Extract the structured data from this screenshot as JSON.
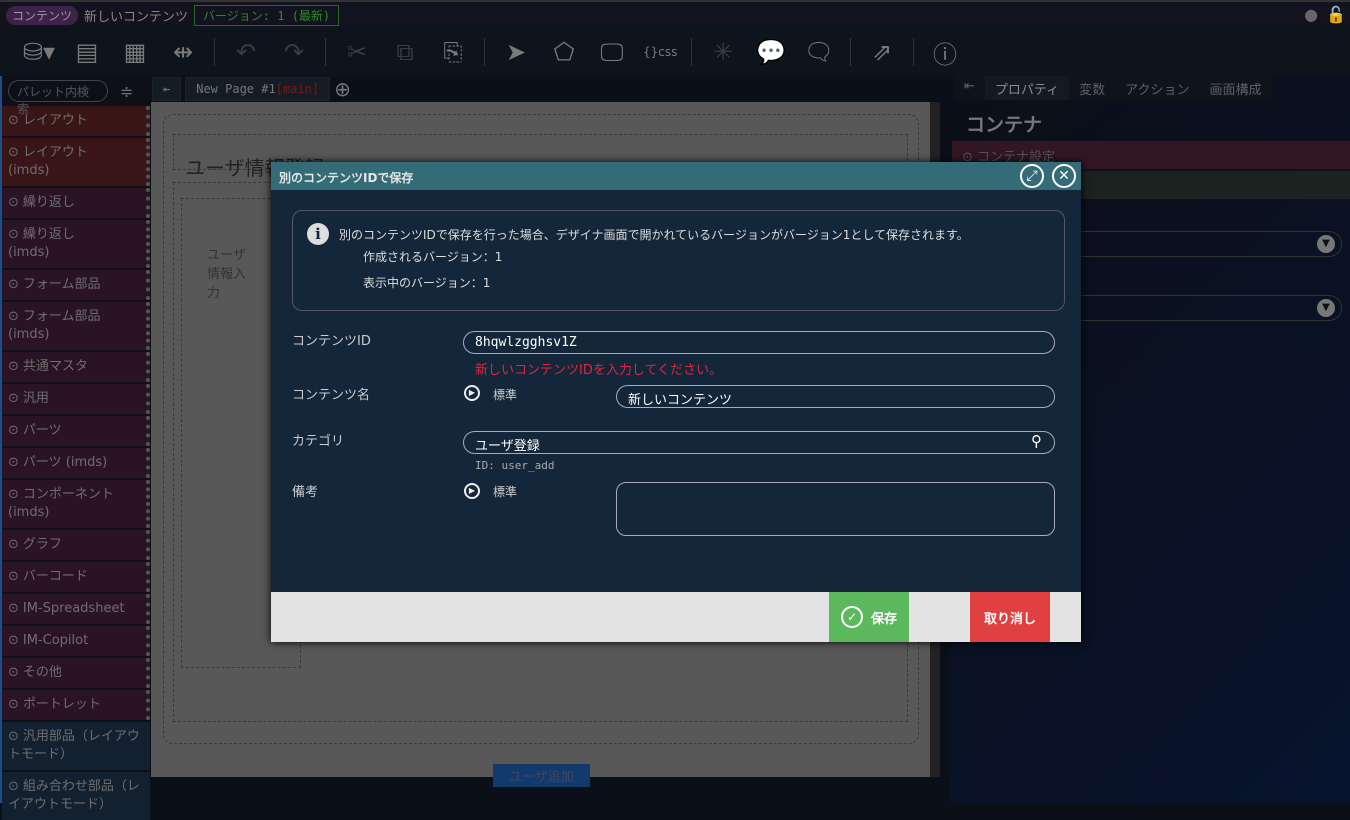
{
  "titlebar": {
    "badge": "コンテンツ",
    "title": "新しいコンテンツ",
    "version": "バージョン: 1 (最新)"
  },
  "palette": {
    "search_placeholder": "パレット内検索",
    "items": [
      {
        "label": "レイアウト",
        "style": "red"
      },
      {
        "label": "レイアウト\n(imds)",
        "style": "red"
      },
      {
        "label": "繰り返し"
      },
      {
        "label": "繰り返し\n(imds)"
      },
      {
        "label": "フォーム部品"
      },
      {
        "label": "フォーム部品\n(imds)"
      },
      {
        "label": "共通マスタ"
      },
      {
        "label": "汎用"
      },
      {
        "label": "パーツ"
      },
      {
        "label": "パーツ (imds)"
      },
      {
        "label": "コンポーネント\n(imds)"
      },
      {
        "label": "グラフ"
      },
      {
        "label": "バーコード"
      },
      {
        "label": "IM-Spreadsheet"
      },
      {
        "label": "IM-Copilot"
      },
      {
        "label": "その他"
      },
      {
        "label": "ポートレット"
      },
      {
        "label": "汎用部品（レイアウトモード）",
        "style": "blue"
      },
      {
        "label": "組み合わせ部品（レイアウトモード）",
        "style": "blue"
      }
    ]
  },
  "tabs": {
    "page": "New Page #1",
    "main": "[main]"
  },
  "canvas": {
    "heading": "ユーザ情報登録",
    "label": "ユーザ情報入力",
    "button": "ユーザ追加"
  },
  "right": {
    "tabs": [
      "プロパティ",
      "変数",
      "アクション",
      "画面構成"
    ],
    "title": "コンテナ",
    "section": "コンテナ設定"
  },
  "dialog": {
    "title": "別のコンテンツIDで保存",
    "info": "別のコンテンツIDで保存を行った場合、デザイナ画面で開かれているバージョンがバージョン1として保存されます。",
    "created_version": "作成されるバージョン：1",
    "shown_version": "表示中のバージョン：1",
    "id_label": "コンテンツID",
    "id_value": "8hqwlzgghsv1Z",
    "id_error": "新しいコンテンツIDを入力してください。",
    "name_label": "コンテンツ名",
    "standard": "標準",
    "name_value": "新しいコンテンツ",
    "category_label": "カテゴリ",
    "category_value": "ユーザ登録",
    "category_id": "ID: user_add",
    "note_label": "備考",
    "note_value": "",
    "save": "保存",
    "cancel": "取り消し"
  }
}
